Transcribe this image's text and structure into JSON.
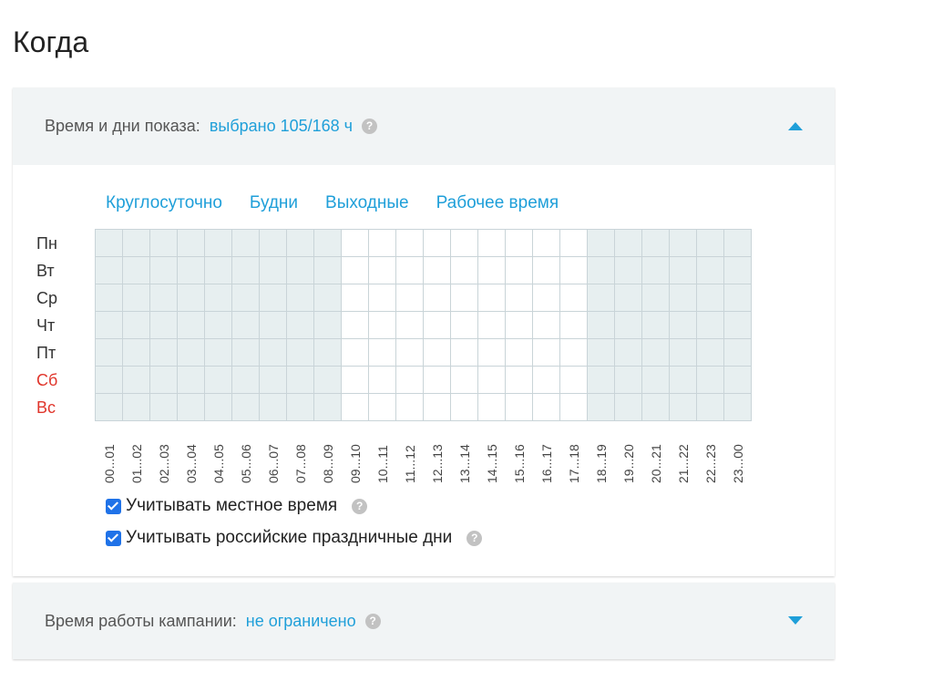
{
  "page": {
    "title": "Когда"
  },
  "schedule": {
    "label": "Время и дни показа:",
    "value": "выбрано 105/168 ч",
    "help": "?",
    "expand_icon": "triangle-up",
    "presets": [
      "Круглосуточно",
      "Будни",
      "Выходные",
      "Рабочее время"
    ],
    "days": [
      {
        "label": "Пн",
        "weekend": false
      },
      {
        "label": "Вт",
        "weekend": false
      },
      {
        "label": "Ср",
        "weekend": false
      },
      {
        "label": "Чт",
        "weekend": false
      },
      {
        "label": "Пт",
        "weekend": false
      },
      {
        "label": "Сб",
        "weekend": true
      },
      {
        "label": "Вс",
        "weekend": true
      }
    ],
    "hours": [
      "00...01",
      "01...02",
      "02...03",
      "03...04",
      "04...05",
      "05...06",
      "06...07",
      "07...08",
      "08...09",
      "09...10",
      "10...11",
      "11...12",
      "12...13",
      "13...14",
      "14...15",
      "15...16",
      "16...17",
      "17...18",
      "18...19",
      "19...20",
      "20...21",
      "21...22",
      "22...23",
      "23...00"
    ],
    "selected_hours": [
      9,
      10,
      11,
      12,
      13,
      14,
      15,
      16,
      17
    ],
    "colors": {
      "link": "#1f9fd9",
      "weekend": "#e0362c",
      "cell_selected": "#ffffff",
      "cell_unselected": "#e7eff0",
      "checkbox": "#1f72e8"
    },
    "options": [
      {
        "label": "Учитывать местное время",
        "checked": true,
        "help": "?"
      },
      {
        "label": "Учитывать российские праздничные дни",
        "checked": true,
        "help": "?"
      }
    ]
  },
  "period": {
    "label": "Время работы кампании:",
    "value": "не ограничено",
    "help": "?",
    "expand_icon": "triangle-down"
  }
}
